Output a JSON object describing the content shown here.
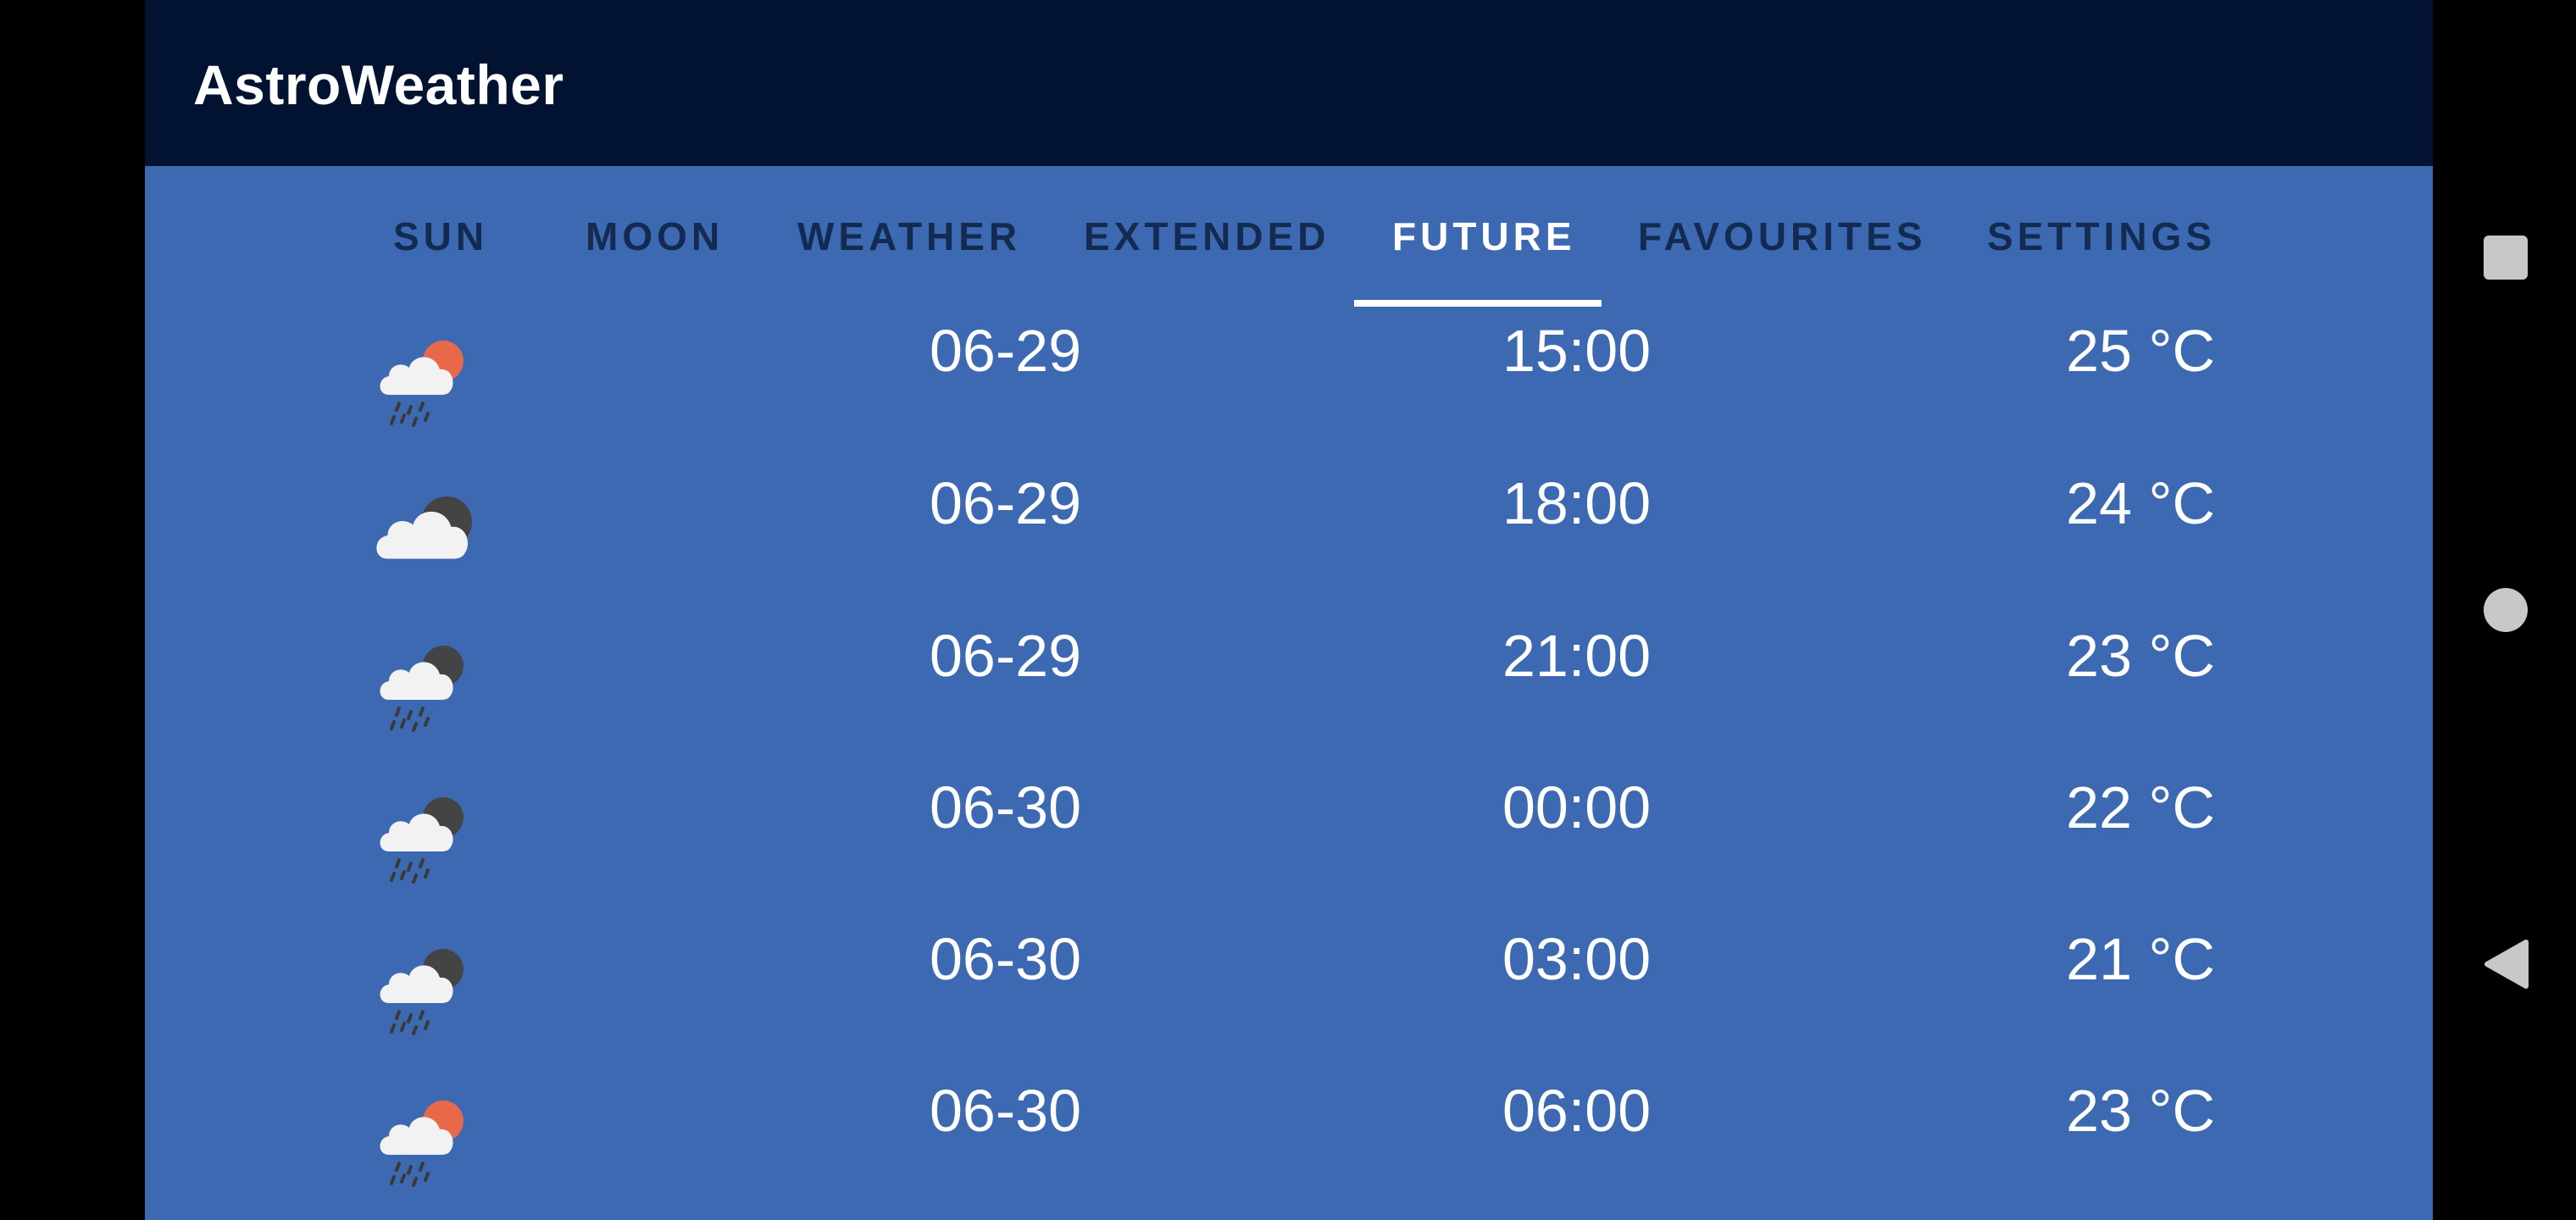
{
  "app": {
    "title": "AstroWeather"
  },
  "tabs": [
    {
      "label": "SUN",
      "active": false
    },
    {
      "label": "MOON",
      "active": false
    },
    {
      "label": "WEATHER",
      "active": false
    },
    {
      "label": "EXTENDED",
      "active": false
    },
    {
      "label": "FUTURE",
      "active": true
    },
    {
      "label": "FAVOURITES",
      "active": false
    },
    {
      "label": "SETTINGS",
      "active": false
    }
  ],
  "forecast": [
    {
      "icon": "rain-cloud-sun-icon",
      "date": "06-29",
      "time": "15:00",
      "temp": "25 °C"
    },
    {
      "icon": "cloud-moon-icon",
      "date": "06-29",
      "time": "18:00",
      "temp": "24 °C"
    },
    {
      "icon": "rain-cloud-moon-icon",
      "date": "06-29",
      "time": "21:00",
      "temp": "23 °C"
    },
    {
      "icon": "rain-cloud-moon-icon",
      "date": "06-30",
      "time": "00:00",
      "temp": "22 °C"
    },
    {
      "icon": "rain-cloud-moon-icon",
      "date": "06-30",
      "time": "03:00",
      "temp": "21 °C"
    },
    {
      "icon": "rain-cloud-sun-icon",
      "date": "06-30",
      "time": "06:00",
      "temp": "23 °C"
    }
  ],
  "navigation": {
    "recents": "square-icon",
    "home": "circle-icon",
    "back": "back-triangle-icon"
  },
  "colors": {
    "appbar": "#011330",
    "background": "#3d69b3",
    "tab_text": "#132b50",
    "tab_active": "#ffffff",
    "sun": "#e8694a",
    "moon": "#444444",
    "cloud": "#f2f2f2"
  }
}
